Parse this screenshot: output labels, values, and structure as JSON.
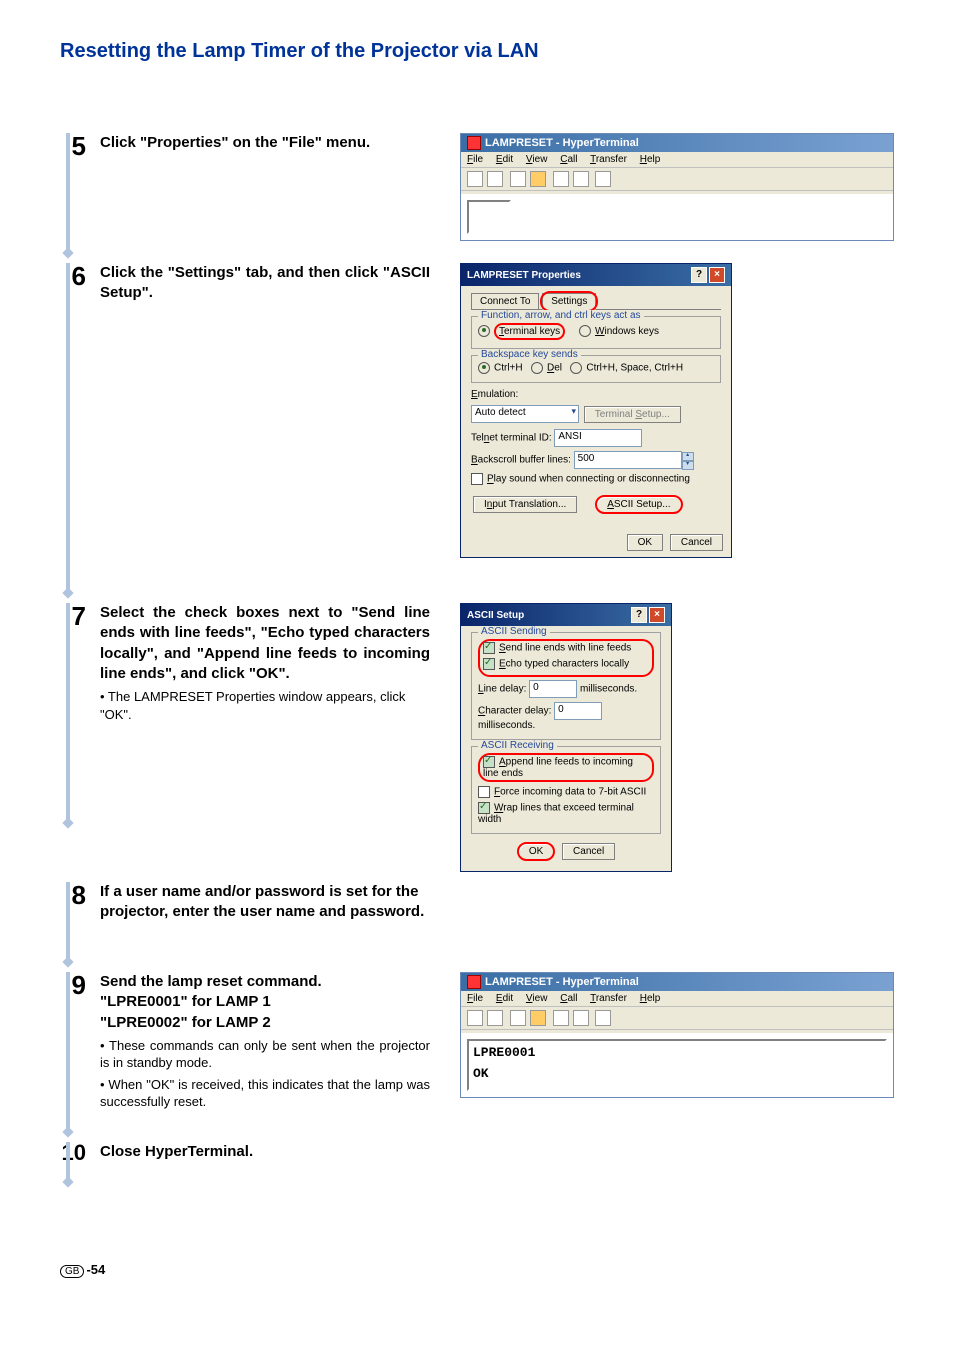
{
  "title": "Resetting the Lamp Timer of the Projector via LAN",
  "steps": {
    "s5": {
      "num": "5",
      "body": "Click \"Properties\" on the \"File\" menu."
    },
    "s6": {
      "num": "6",
      "body": "Click the \"Settings\" tab, and then click \"ASCII Setup\"."
    },
    "s7": {
      "num": "7",
      "body": "Select the check boxes next to \"Send line ends with line feeds\", \"Echo typed characters locally\", and \"Append line feeds to incoming line ends\", and click \"OK\".",
      "sub": "• The LAMPRESET Properties window appears, click \"OK\"."
    },
    "s8": {
      "num": "8",
      "body": "If a user name and/or password is set for the projector, enter the user name and password."
    },
    "s9": {
      "num": "9",
      "body_l1": "Send the lamp reset command.",
      "body_l2": "\"LPRE0001\" for LAMP 1",
      "body_l3": "\"LPRE0002\" for LAMP 2",
      "sub1": "• These commands can only be sent when the projector is in standby mode.",
      "sub2": "• When \"OK\" is received, this indicates that the lamp was successfully reset."
    },
    "s10": {
      "num": "10",
      "body": "Close HyperTerminal."
    }
  },
  "hyper": {
    "title": "LAMPRESET - HyperTerminal",
    "menu": {
      "file": "File",
      "edit": "Edit",
      "view": "View",
      "call": "Call",
      "transfer": "Transfer",
      "help": "Help"
    },
    "term_line1": "LPRE0001",
    "term_line2": "OK"
  },
  "props_dialog": {
    "title": "LAMPRESET Properties",
    "tab_connect": "Connect To",
    "tab_settings": "Settings",
    "group_keys": "Function, arrow, and ctrl keys act as",
    "radio_terminal": "Terminal keys",
    "radio_windows": "Windows keys",
    "group_backspace": "Backspace key sends",
    "radio_ctrlh": "Ctrl+H",
    "radio_del": "Del",
    "radio_ctrlhspace": "Ctrl+H, Space, Ctrl+H",
    "label_emulation": "Emulation:",
    "emulation_value": "Auto detect",
    "btn_termsetup": "Terminal Setup...",
    "label_telnet": "Telnet terminal ID:",
    "telnet_value": "ANSI",
    "label_backscroll": "Backscroll buffer lines:",
    "backscroll_value": "500",
    "check_playsound": "Play sound when connecting or disconnecting",
    "btn_input": "Input Translation...",
    "btn_ascii": "ASCII Setup...",
    "btn_ok": "OK",
    "btn_cancel": "Cancel"
  },
  "ascii_dialog": {
    "title": "ASCII Setup",
    "group_send": "ASCII Sending",
    "chk_sendlf": "Send line ends with line feeds",
    "chk_echo": "Echo typed characters locally",
    "label_linedelay": "Line delay:",
    "linedelay_value": "0",
    "unit_ms": "milliseconds.",
    "label_chardelay": "Character delay:",
    "chardelay_value": "0",
    "group_recv": "ASCII Receiving",
    "chk_append": "Append line feeds to incoming line ends",
    "chk_force7": "Force incoming data to 7-bit ASCII",
    "chk_wrap": "Wrap lines that exceed terminal width",
    "btn_ok": "OK",
    "btn_cancel": "Cancel"
  },
  "page_num": {
    "gb": "GB",
    "num": "-54"
  }
}
